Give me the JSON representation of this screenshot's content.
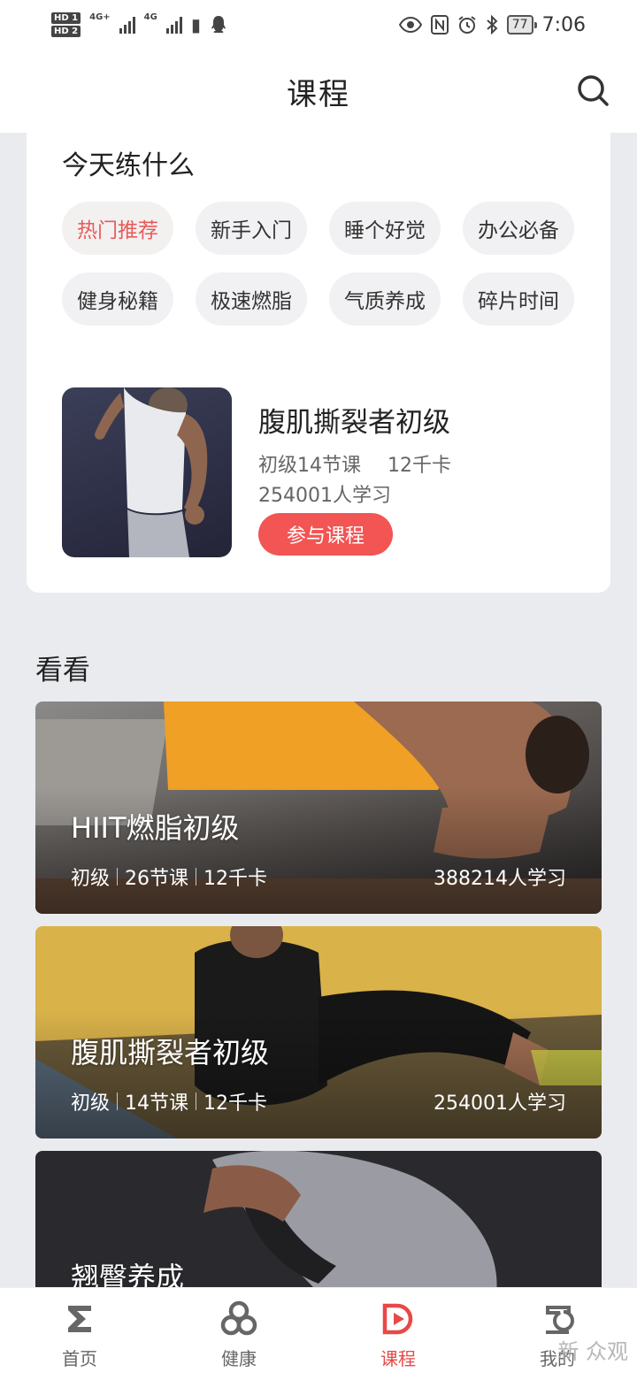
{
  "status_bar": {
    "hd1": "HD 1",
    "hd2": "HD 2",
    "net1": "4G+",
    "net2": "4G",
    "battery": "77",
    "time": "7:06"
  },
  "nav": {
    "title": "课程"
  },
  "today": {
    "title": "今天练什么",
    "chips": [
      "热门推荐",
      "新手入门",
      "睡个好觉",
      "办公必备",
      "健身秘籍",
      "极速燃脂",
      "气质养成",
      "碎片时间"
    ],
    "featured": {
      "title": "腹肌撕裂者初级",
      "level": "初级14节课",
      "calories": "12千卡",
      "learners": "254001人学习",
      "button": "参与课程"
    }
  },
  "look": {
    "title": "看看",
    "courses": [
      {
        "name": "HIIT燃脂初级",
        "level": "初级",
        "lessons": "26节课",
        "calories": "12千卡",
        "learners": "388214人学习"
      },
      {
        "name": "腹肌撕裂者初级",
        "level": "初级",
        "lessons": "14节课",
        "calories": "12千卡",
        "learners": "254001人学习"
      },
      {
        "name": "翘臀养成"
      }
    ]
  },
  "tabs": [
    {
      "label": "首页",
      "icon": "sigma-home-icon"
    },
    {
      "label": "健康",
      "icon": "health-rings-icon"
    },
    {
      "label": "课程",
      "icon": "course-play-icon"
    },
    {
      "label": "我的",
      "icon": "profile-icon"
    }
  ],
  "colors": {
    "accent": "#e84846",
    "button": "#f25553",
    "chip_bg": "#f1f1f3"
  },
  "watermark": "新 众观"
}
